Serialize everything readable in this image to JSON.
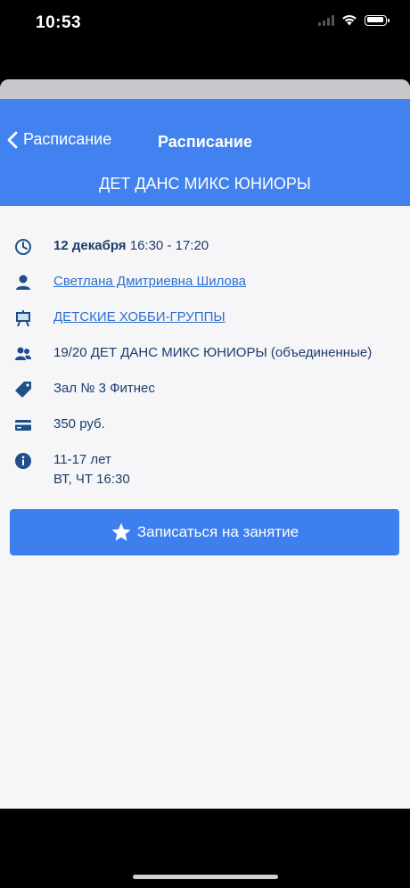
{
  "status_bar": {
    "time": "10:53"
  },
  "nav": {
    "back_label": "Расписание",
    "title": "Расписание",
    "subtitle": "ДЕТ ДАНС МИКС ЮНИОРЫ"
  },
  "details": {
    "date_bold": "12 декабря",
    "time_range": "16:30 - 17:20",
    "trainer": "Светлана Дмитриевна Шилова",
    "category": "ДЕТСКИЕ ХОББИ-ГРУППЫ",
    "group": "19/20 ДЕТ ДАНС МИКС ЮНИОРЫ (объединенные)",
    "location": "Зал № 3 Фитнес",
    "price": "350 руб.",
    "info_line1": "11-17 лет",
    "info_line2": "ВТ, ЧТ 16:30"
  },
  "enroll_button": {
    "label": "Записаться на занятие"
  },
  "icons": {
    "time": "clock-icon",
    "trainer": "person-icon",
    "category": "easel-icon",
    "group": "people-icon",
    "location": "tag-icon",
    "price": "card-icon",
    "info": "info-icon",
    "enroll": "star-icon"
  },
  "colors": {
    "nav_bg": "#4282f0",
    "button_bg": "#3e7fef",
    "text": "#1b3d6b",
    "link": "#2f6fce",
    "icon": "#1f4f8a"
  }
}
